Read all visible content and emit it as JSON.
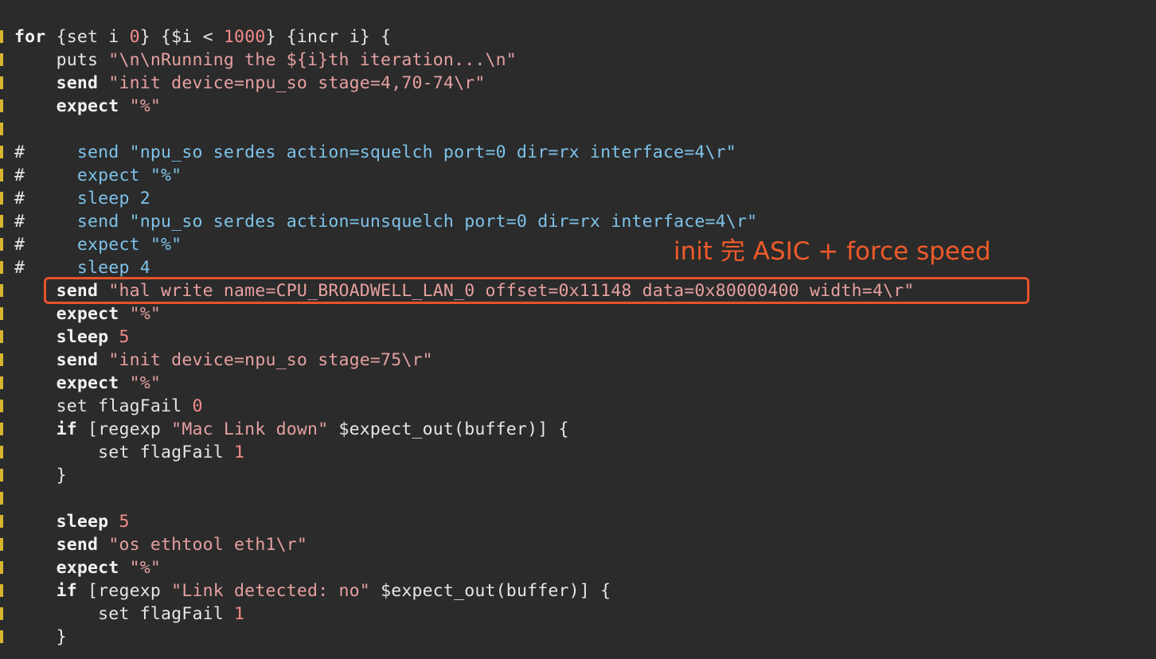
{
  "annotation": "init 完 ASIC + force speed",
  "colors": {
    "background": "#2b2b2b",
    "keyword": "#f2f2f2",
    "string": "#e6a0a0",
    "number": "#f48b8b",
    "comment": "#7ec3ea",
    "highlight": "#e8532a",
    "gutter": "#d7b52e"
  },
  "lines": [
    [
      [
        "kw",
        "for"
      ],
      [
        "plain",
        " {set i "
      ],
      [
        "num",
        "0"
      ],
      [
        "plain",
        "} {$i < "
      ],
      [
        "num",
        "1000"
      ],
      [
        "plain",
        "} {incr i} {"
      ]
    ],
    [
      [
        "plain",
        "    puts "
      ],
      [
        "str",
        "\"\\n\\nRunning the ${i}th iteration...\\n\""
      ]
    ],
    [
      [
        "kw",
        "    send"
      ],
      [
        "plain",
        " "
      ],
      [
        "str",
        "\"init device=npu_so stage=4,70-74\\r\""
      ]
    ],
    [
      [
        "kw",
        "    expect"
      ],
      [
        "plain",
        " "
      ],
      [
        "str",
        "\"%\""
      ]
    ],
    [],
    [
      [
        "hash",
        "#"
      ],
      [
        "cm",
        "     send \"npu_so serdes action=squelch port=0 dir=rx interface=4\\r\""
      ]
    ],
    [
      [
        "hash",
        "#"
      ],
      [
        "cm",
        "     expect \"%\""
      ]
    ],
    [
      [
        "hash",
        "#"
      ],
      [
        "cm",
        "     sleep 2"
      ]
    ],
    [
      [
        "hash",
        "#"
      ],
      [
        "cm",
        "     send \"npu_so serdes action=unsquelch port=0 dir=rx interface=4\\r\""
      ]
    ],
    [
      [
        "hash",
        "#"
      ],
      [
        "cm",
        "     expect \"%\""
      ]
    ],
    [
      [
        "hash",
        "#"
      ],
      [
        "cm",
        "     sleep 4"
      ]
    ],
    [
      [
        "kw",
        "    send"
      ],
      [
        "plain",
        " "
      ],
      [
        "str",
        "\"hal write name=CPU_BROADWELL_LAN_0 offset=0x11148 data=0x80000400 width=4\\r\""
      ]
    ],
    [
      [
        "kw",
        "    expect"
      ],
      [
        "plain",
        " "
      ],
      [
        "str",
        "\"%\""
      ]
    ],
    [
      [
        "kw",
        "    sleep"
      ],
      [
        "plain",
        " "
      ],
      [
        "num",
        "5"
      ]
    ],
    [
      [
        "kw",
        "    send"
      ],
      [
        "plain",
        " "
      ],
      [
        "str",
        "\"init device=npu_so stage=75\\r\""
      ]
    ],
    [
      [
        "kw",
        "    expect"
      ],
      [
        "plain",
        " "
      ],
      [
        "str",
        "\"%\""
      ]
    ],
    [
      [
        "plain",
        "    set flagFail "
      ],
      [
        "num",
        "0"
      ]
    ],
    [
      [
        "kw",
        "    if"
      ],
      [
        "plain",
        " [regexp "
      ],
      [
        "str",
        "\"Mac Link down\""
      ],
      [
        "plain",
        " $expect_out(buffer)] {"
      ]
    ],
    [
      [
        "plain",
        "        set flagFail "
      ],
      [
        "num",
        "1"
      ]
    ],
    [
      [
        "plain",
        "    }"
      ]
    ],
    [],
    [
      [
        "kw",
        "    sleep"
      ],
      [
        "plain",
        " "
      ],
      [
        "num",
        "5"
      ]
    ],
    [
      [
        "kw",
        "    send"
      ],
      [
        "plain",
        " "
      ],
      [
        "str",
        "\"os ethtool eth1\\r\""
      ]
    ],
    [
      [
        "kw",
        "    expect"
      ],
      [
        "plain",
        " "
      ],
      [
        "str",
        "\"%\""
      ]
    ],
    [
      [
        "kw",
        "    if"
      ],
      [
        "plain",
        " [regexp "
      ],
      [
        "str",
        "\"Link detected: no\""
      ],
      [
        "plain",
        " $expect_out(buffer)] {"
      ]
    ],
    [
      [
        "plain",
        "        set flagFail "
      ],
      [
        "num",
        "1"
      ]
    ],
    [
      [
        "plain",
        "    }"
      ]
    ]
  ]
}
